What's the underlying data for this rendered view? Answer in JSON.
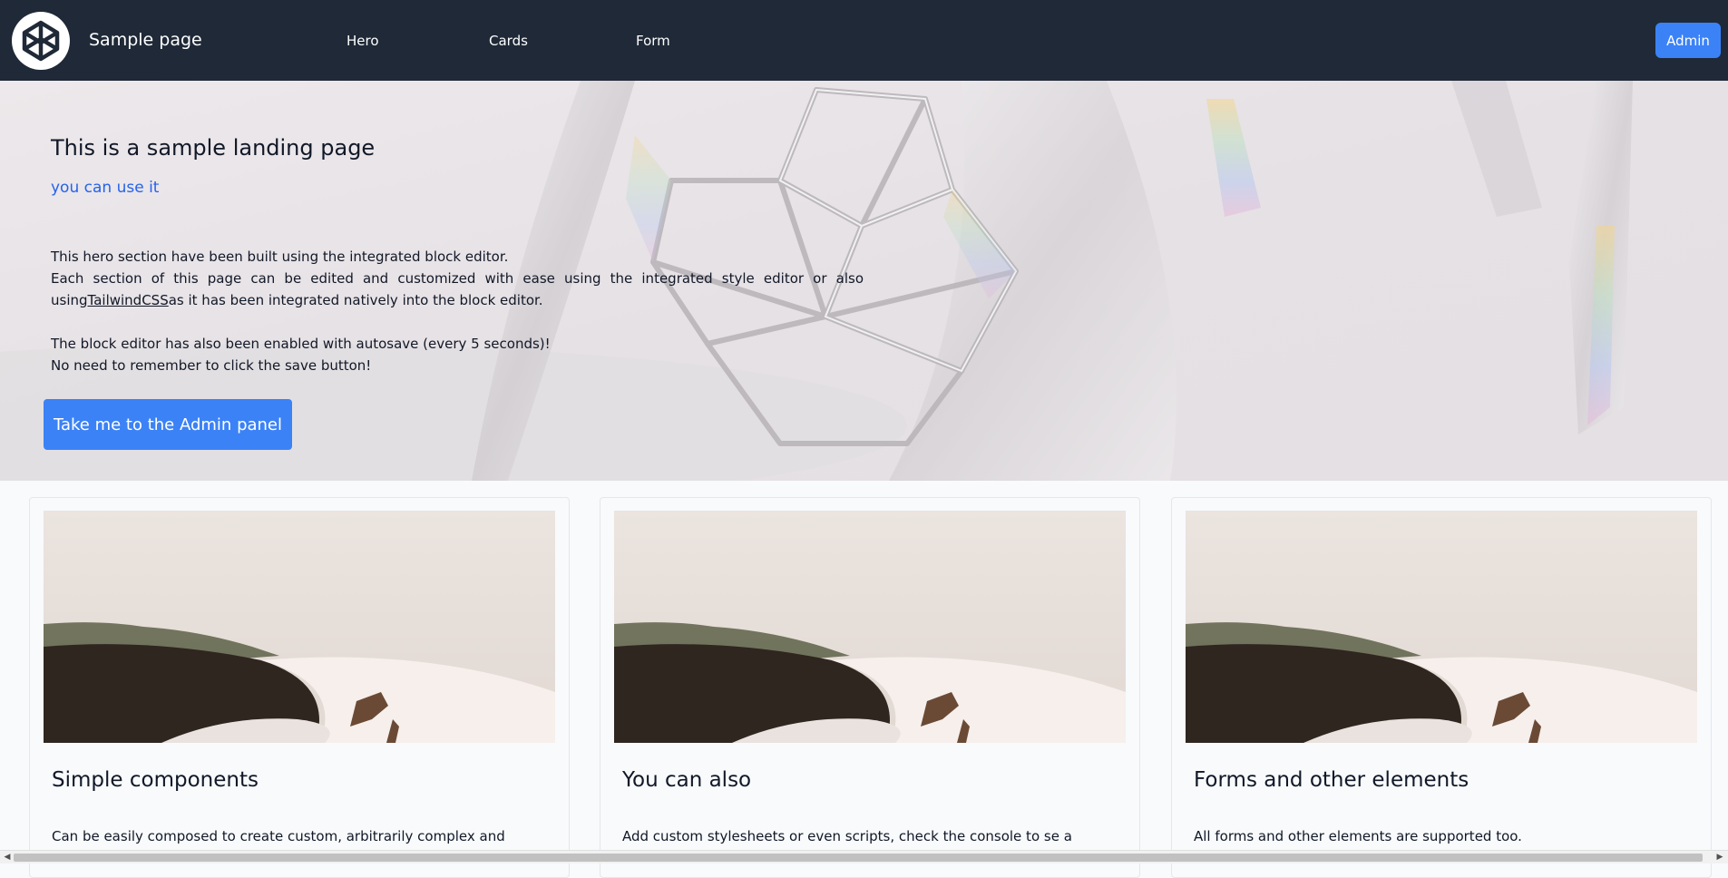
{
  "nav": {
    "brand": "Sample page",
    "links": [
      "Hero",
      "Cards",
      "Form"
    ],
    "admin_label": "Admin"
  },
  "hero": {
    "title": "This is a sample landing page",
    "subtitle": "you can use it",
    "line1": "This hero section have been built using the integrated block editor.",
    "line2_pre": "Each section of this page can be edited and customized with ease using the integrated style editor or also using",
    "line2_link": "TailwindCSS",
    "line2_post": "as it has been integrated natively into the block editor.",
    "line3": "The block editor has also been enabled with autosave (every 5 seconds)!",
    "line4": "No need to remember to click the save button!",
    "cta_label": "Take me to the Admin panel"
  },
  "cards": [
    {
      "title": "Simple components",
      "text": "Can be easily composed to create custom, arbitrarily complex and"
    },
    {
      "title": "You can also",
      "text": "Add custom stylesheets or even scripts, check the console to se a secret"
    },
    {
      "title": "Forms and other elements",
      "text": "All forms and other elements are supported too."
    }
  ],
  "colors": {
    "nav_bg": "#1f2937",
    "accent": "#3b82f6",
    "subtitle": "#2563eb"
  }
}
